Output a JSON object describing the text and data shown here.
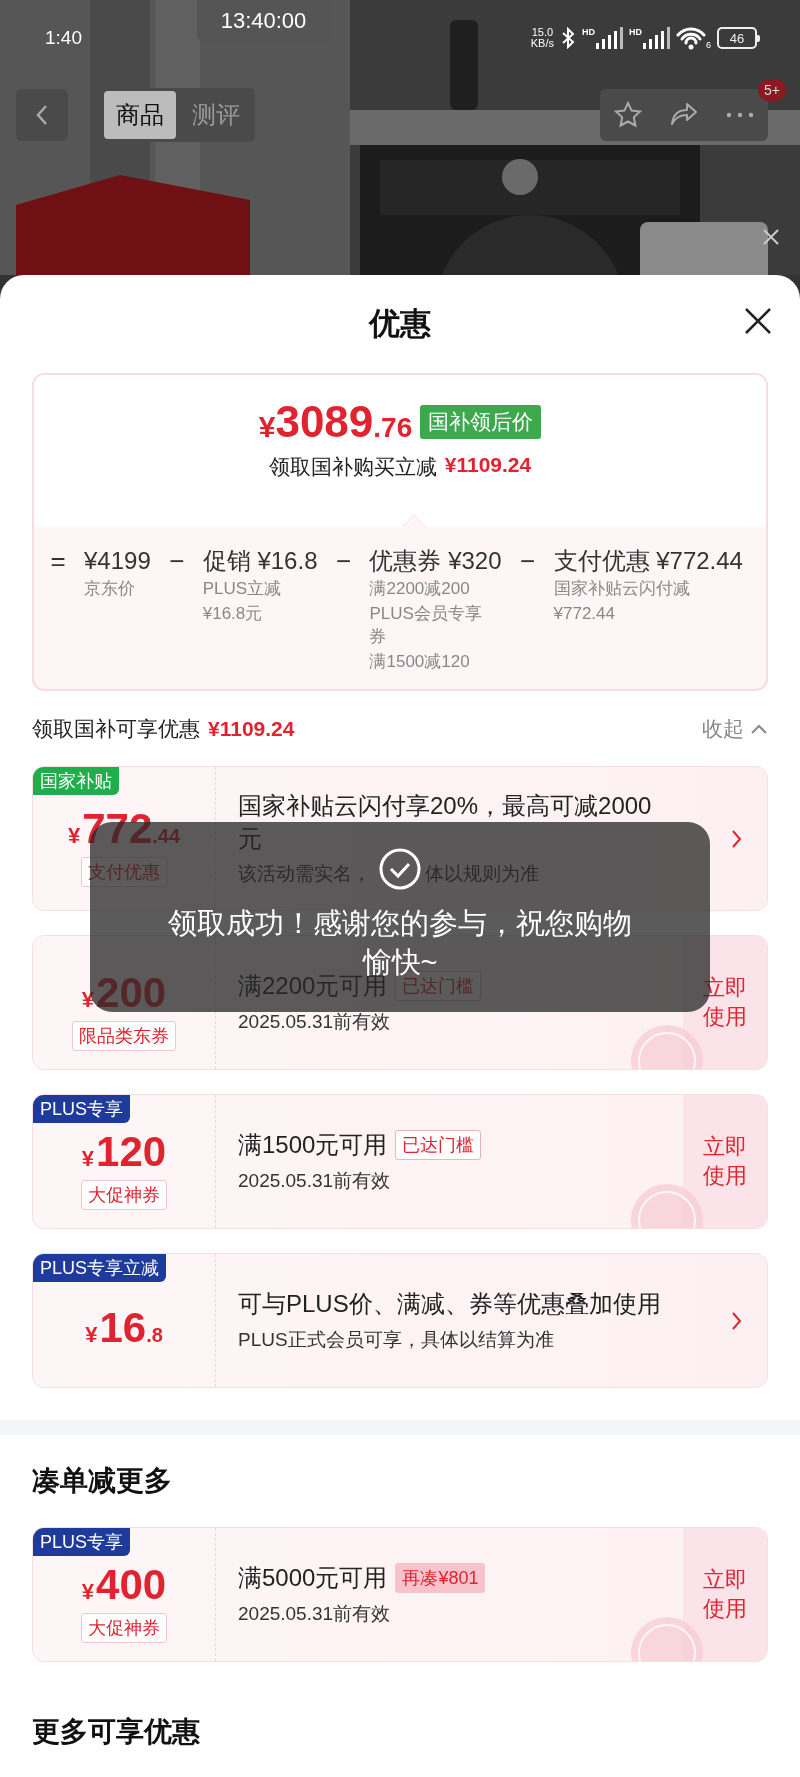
{
  "status_bar": {
    "time": "1:40",
    "clock": "13:40:00",
    "speed": "15.0",
    "speed_unit": "KB/s",
    "signal_labels": [
      "HD",
      "HD"
    ],
    "wifi_label": "6",
    "battery": "46"
  },
  "nav": {
    "tabs": [
      {
        "label": "商品",
        "selected": true
      },
      {
        "label": "测评",
        "selected": false
      }
    ],
    "badge": "5+"
  },
  "sheet": {
    "title": "优惠"
  },
  "price_card": {
    "currency": "¥",
    "price_int": "3089",
    "price_dec": ".76",
    "price_tag": "国补领后价",
    "subtitle": "领取国补购买立减",
    "subtitle_amount": "¥1109.24",
    "breakdown": [
      {
        "operator": "=",
        "title": "¥4199",
        "notes": [
          "京东价"
        ]
      },
      {
        "operator": "−",
        "title": "促销 ¥16.8",
        "notes": [
          "PLUS立减",
          "¥16.8元"
        ]
      },
      {
        "operator": "−",
        "title": "优惠券 ¥320",
        "notes": [
          "满2200减200",
          "PLUS会员专享券",
          "满1500减120"
        ]
      },
      {
        "operator": "−",
        "title": "支付优惠 ¥772.44",
        "notes": [
          "国家补贴云闪付减",
          "¥772.44"
        ]
      }
    ]
  },
  "offers": {
    "title": "领取国补可享优惠",
    "amount": "¥1109.24",
    "toggle": "收起",
    "coupons": [
      {
        "kind": "detail",
        "tag": "国家补贴",
        "color": "#1fae4b",
        "currency": "¥",
        "amount": "772",
        "decimal": ".44",
        "label": "支付优惠",
        "title": "国家补贴云闪付享20%，最高可减2000元",
        "subtitle": "该活动需实名，",
        "subtitle_rest": "体以规则为准"
      },
      {
        "kind": "voucher",
        "currency": "¥",
        "amount": "200",
        "label": "限品类东券",
        "title": "满2200元可用",
        "status": "已达门槛",
        "threshold_reached": true,
        "subtitle": "2025.05.31前有效",
        "action": "立即使用"
      },
      {
        "kind": "voucher",
        "tag": "PLUS专享",
        "color": "#1e3a9a",
        "currency": "¥",
        "amount": "120",
        "label": "大促神券",
        "title": "满1500元可用",
        "status": "已达门槛",
        "threshold_reached": true,
        "subtitle": "2025.05.31前有效",
        "action": "立即使用"
      },
      {
        "kind": "detail",
        "tag": "PLUS专享立减",
        "color": "#1e3a9a",
        "currency": "¥",
        "amount": "16",
        "decimal": ".8",
        "title": "可与PLUS价、满减、券等优惠叠加使用",
        "subtitle": "PLUS正式会员可享，具体以结算为准"
      }
    ]
  },
  "bundle": {
    "title": "凑单减更多",
    "coupons": [
      {
        "kind": "voucher",
        "tag": "PLUS专享",
        "color": "#1e3a9a",
        "currency": "¥",
        "amount": "400",
        "label": "大促神券",
        "title": "满5000元可用",
        "status": "再凑¥801",
        "threshold_reached": false,
        "subtitle": "2025.05.31前有效",
        "action": "立即使用"
      }
    ]
  },
  "more": {
    "title": "更多可享优惠"
  },
  "toast": {
    "message": "领取成功！感谢您的参与，祝您购物愉快~"
  }
}
